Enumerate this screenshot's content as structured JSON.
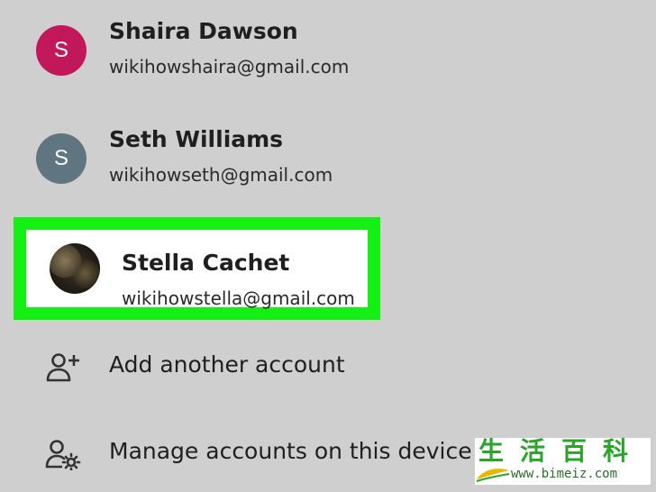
{
  "accounts": [
    {
      "avatar_letter": "S",
      "avatar_color": "#c2185b",
      "name": "Shaira Dawson",
      "email": "wikihowshaira@gmail.com"
    },
    {
      "avatar_letter": "S",
      "avatar_color": "#5f7580",
      "name": "Seth Williams",
      "email": "wikihowseth@gmail.com"
    },
    {
      "avatar_letter": "",
      "avatar_color": "",
      "name": "Stella Cachet",
      "email": "wikihowstella@gmail.com",
      "highlighted": true
    }
  ],
  "actions": {
    "add_account": {
      "icon": "person-add-icon",
      "label": "Add another account"
    },
    "manage_accounts": {
      "icon": "manage-accounts-icon",
      "label": "Manage accounts on this device"
    }
  },
  "highlight_color": "#14ef14",
  "watermark": {
    "chars": "生活百科",
    "url": "www.bimeiz.com"
  }
}
